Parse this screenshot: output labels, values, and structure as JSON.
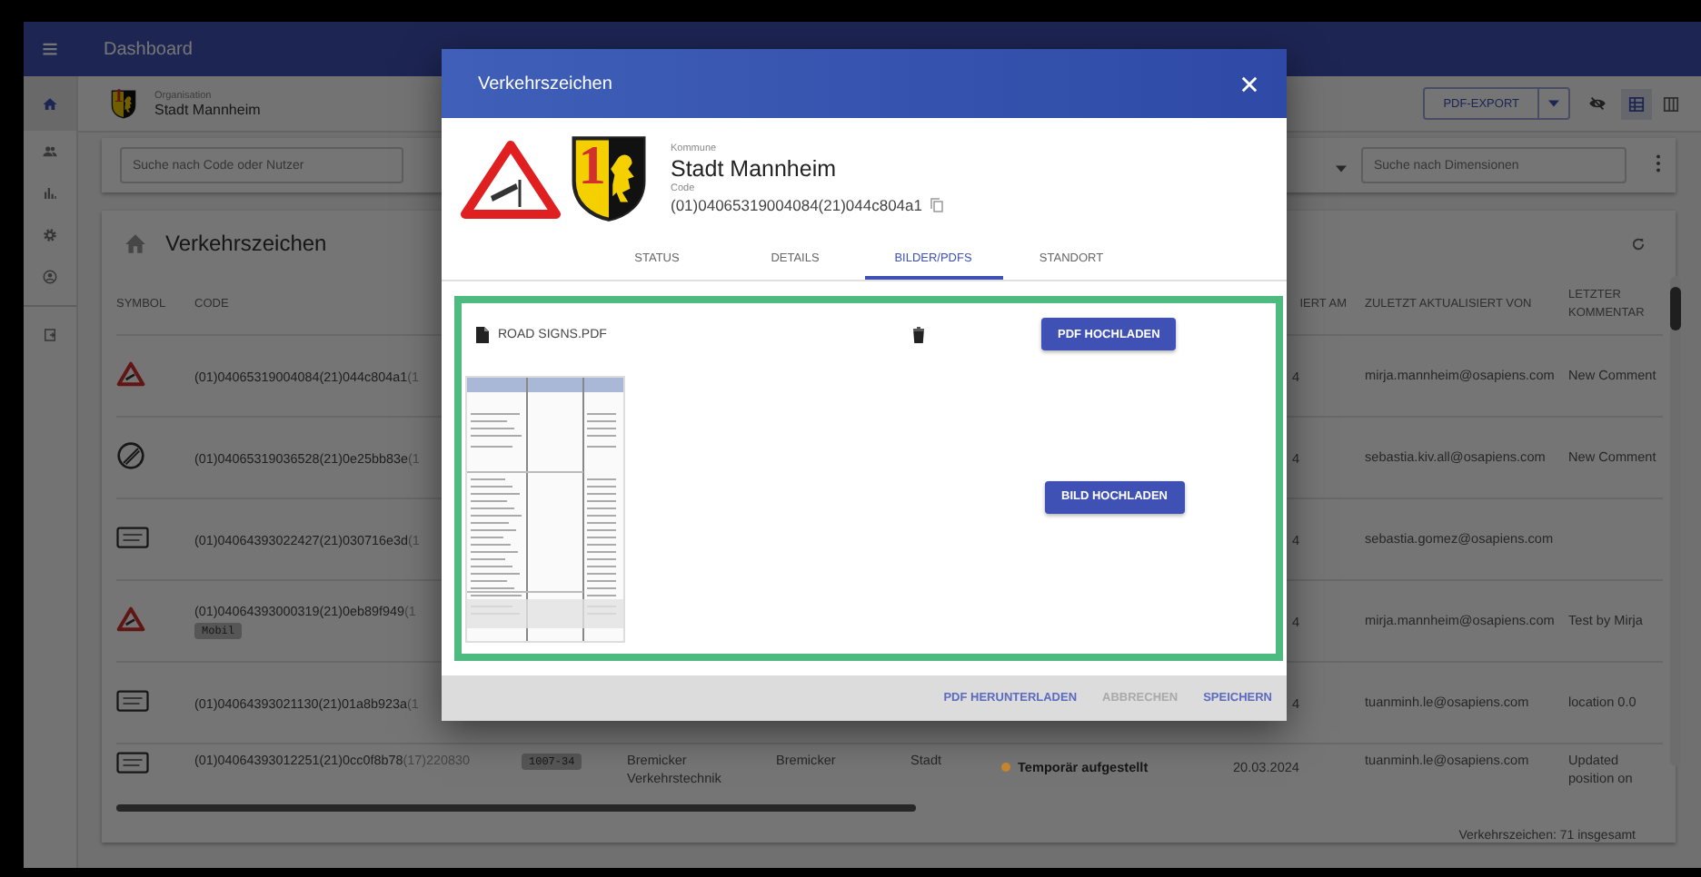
{
  "app_bar": {
    "title": "Dashboard"
  },
  "sidebar": {
    "items": [
      {
        "kind": "home",
        "selected": true
      },
      {
        "kind": "people",
        "selected": false
      },
      {
        "kind": "chart",
        "selected": false
      },
      {
        "kind": "settings",
        "selected": false
      },
      {
        "kind": "account",
        "selected": false
      },
      {
        "kind": "logout",
        "selected": false
      }
    ]
  },
  "organisation": {
    "label": "Organisation",
    "name": "Stadt Mannheim",
    "crest_numeral": "1"
  },
  "toolbar": {
    "export_button": "PDF-EXPORT",
    "view_modes": [
      {
        "kind": "table",
        "selected": true
      },
      {
        "kind": "cards",
        "selected": false
      }
    ]
  },
  "filters": {
    "code_search": {
      "placeholder": "Suche nach Code oder Nutzer"
    },
    "dimension_search": {
      "placeholder": "Suche nach Dimensionen"
    }
  },
  "table": {
    "title": "Verkehrszeichen",
    "headers": {
      "symbol": "SYMBOL",
      "code": "CODE",
      "date": "IERT AM",
      "updated_by": "ZULETZT AKTUALISIERT VON",
      "comment": "LETZTER KOMMENTAR"
    },
    "rows": [
      {
        "kind": "warning",
        "code": "(01)04065319004084(21)044c804a1",
        "code_suffix": "(1",
        "date": "4",
        "updated_by": "mirja.mannheim@osapiens.com",
        "comment": "New Comment"
      },
      {
        "kind": "end-restriction",
        "code": "(01)04065319036528(21)0e25bb83e",
        "code_suffix": "(1",
        "date": "4",
        "updated_by": "sebastia.kiv.all@osapiens.com",
        "comment": "New Comment"
      },
      {
        "kind": "panel",
        "code": "(01)04064393022427(21)030716e3d",
        "code_suffix": "(1",
        "date": "4",
        "updated_by": "sebastia.gomez@osapiens.com"
      },
      {
        "kind": "warning",
        "code": "(01)04064393000319(21)0eb89f949",
        "code_suffix": "(1",
        "tag": "Mobil",
        "date": "4",
        "updated_by": "mirja.mannheim@osapiens.com",
        "comment": "Test by Mirja"
      },
      {
        "kind": "panel",
        "code": "(01)04064393021130(21)01a8b923a",
        "code_suffix": "(1",
        "date": "4",
        "updated_by": "tuanminh.le@osapiens.com",
        "comment": "location 0.0"
      },
      {
        "kind": "panel",
        "code": "(01)04064393012251(21)0cc0f8b78",
        "code_suffix": "(17)220830",
        "dimension": "1007-34",
        "manufacturer": "Bremicker Verkehrstechnik",
        "supplier": "Bremicker",
        "city": "Stadt",
        "status": {
          "label": "Temporär aufgestellt",
          "color": "#c8842c"
        },
        "date": "20.03.2024",
        "updated_by": "tuanminh.le@osapiens.com",
        "comment": "Updated position on"
      }
    ],
    "footer": "Verkehrszeichen: 71 insgesamt"
  },
  "dialog": {
    "title": "Verkehrszeichen",
    "crest_numeral": "1",
    "kommune_label": "Kommune",
    "kommune": "Stadt Mannheim",
    "code_label": "Code",
    "code": "(01)04065319004084(21)044c804a1",
    "tabs": [
      {
        "label": "STATUS",
        "selected": false
      },
      {
        "label": "DETAILS",
        "selected": false
      },
      {
        "label": "BILDER/PDFS",
        "selected": true
      },
      {
        "label": "STANDORT",
        "selected": false
      }
    ],
    "file": {
      "name": "ROAD SIGNS.PDF"
    },
    "pdf_upload": "PDF HOCHLADEN",
    "image_upload": "BILD HOCHLADEN",
    "actions": [
      {
        "label": "PDF HERUNTERLADEN",
        "disabled": false
      },
      {
        "label": "ABBRECHEN",
        "disabled": true
      },
      {
        "label": "SPEICHERN",
        "disabled": false
      }
    ]
  }
}
